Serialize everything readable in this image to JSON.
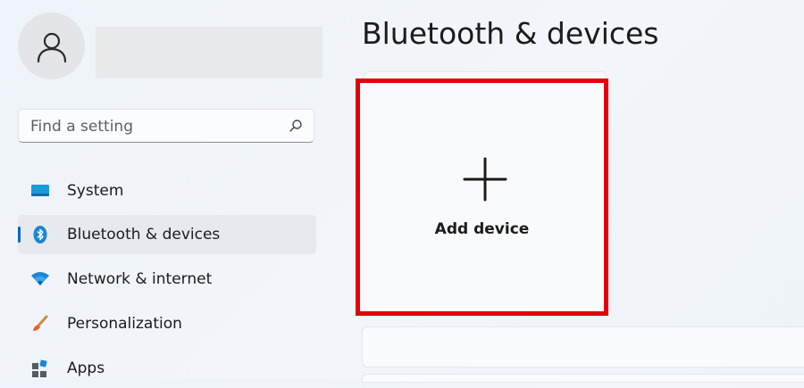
{
  "sidebar": {
    "search": {
      "placeholder": "Find a setting"
    },
    "items": [
      {
        "label": "System",
        "icon": "monitor-icon"
      },
      {
        "label": "Bluetooth & devices",
        "icon": "bluetooth-icon",
        "active": true
      },
      {
        "label": "Network & internet",
        "icon": "wifi-icon"
      },
      {
        "label": "Personalization",
        "icon": "paintbrush-icon"
      },
      {
        "label": "Apps",
        "icon": "apps-icon"
      }
    ]
  },
  "main": {
    "title": "Bluetooth & devices",
    "add_device": {
      "label": "Add device",
      "icon": "plus-icon"
    }
  },
  "colors": {
    "accent": "#0067c0",
    "highlight_border": "#e3000b"
  }
}
